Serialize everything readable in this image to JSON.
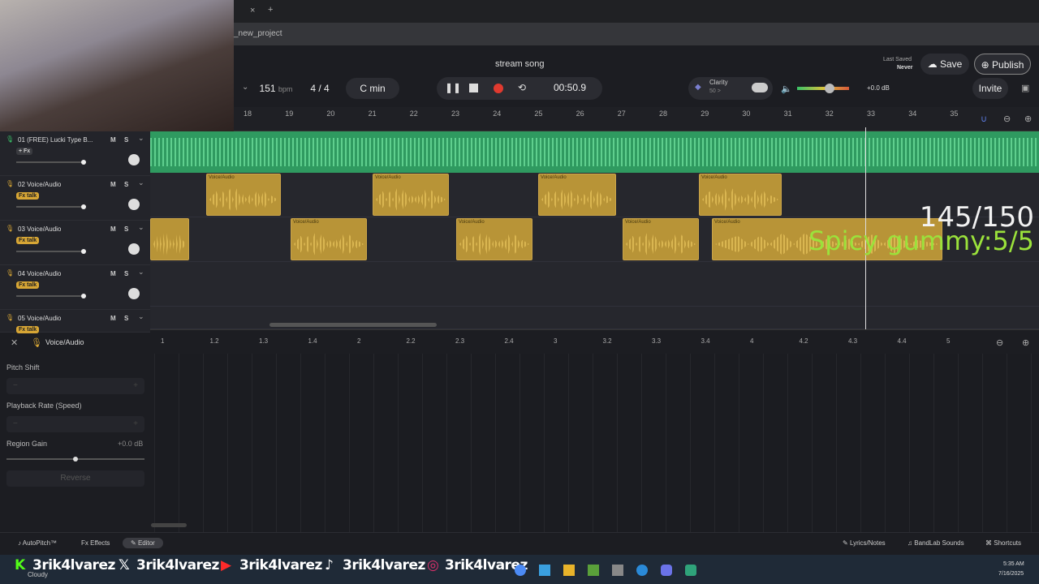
{
  "browser": {
    "url": "_new_project",
    "tab_close": "×",
    "new_tab": "+"
  },
  "project": {
    "title": "stream song",
    "last_saved_label": "Last Saved",
    "last_saved_value": "Never",
    "save": "Save",
    "publish": "Publish",
    "invite": "Invite"
  },
  "transport": {
    "bpm": "151",
    "bpm_unit": "bpm",
    "time_sig": "4 / 4",
    "key": "C min",
    "time": "00:50.9"
  },
  "clarity": {
    "label": "Clarity",
    "value": "50 >"
  },
  "master": {
    "db": "+0.0 dB",
    "volume": 0.62
  },
  "ruler": [
    "18",
    "19",
    "20",
    "21",
    "22",
    "23",
    "24",
    "25",
    "26",
    "27",
    "28",
    "29",
    "30",
    "31",
    "32",
    "33",
    "34",
    "35"
  ],
  "tracks": [
    {
      "name": "01  (FREE) Lucki Type B...",
      "fx": "+ Fx"
    },
    {
      "name": "02  Voice/Audio",
      "fx": "Fx talk"
    },
    {
      "name": "03  Voice/Audio",
      "fx": "Fx talk"
    },
    {
      "name": "04  Voice/Audio",
      "fx": "Fx talk"
    },
    {
      "name": "05  Voice/Audio",
      "fx": "Fx talk"
    }
  ],
  "track_buttons": {
    "m": "M",
    "s": "S"
  },
  "clip_label": "Voice/Audio",
  "overlays": {
    "count": "145/150",
    "gummy": "Spicy gummy:5/5"
  },
  "editor": {
    "track": "Voice/Audio",
    "ruler": [
      "1",
      "1.2",
      "1.3",
      "1.4",
      "2",
      "2.2",
      "2.3",
      "2.4",
      "3",
      "3.2",
      "3.3",
      "3.4",
      "4",
      "4.2",
      "4.3",
      "4.4",
      "5"
    ],
    "pitch_shift": "Pitch Shift",
    "playback_rate": "Playback Rate (Speed)",
    "region_gain": "Region Gain",
    "region_gain_value": "+0.0 dB",
    "reverse": "Reverse"
  },
  "bottom": {
    "autopitch": "AutoPitch™",
    "effects": "Effects",
    "editor": "Editor",
    "lyrics": "Lyrics/Notes",
    "sounds": "BandLab Sounds",
    "shortcuts": "Shortcuts"
  },
  "taskbar": {
    "weather": "Cloudy",
    "time": "5:35 AM",
    "date": "7/16/2025",
    "handle": "3rik4lvarez"
  }
}
